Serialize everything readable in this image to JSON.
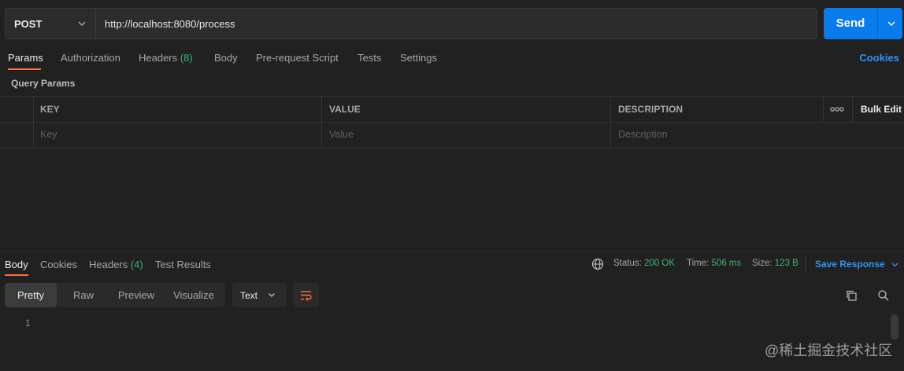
{
  "request": {
    "method": "POST",
    "url": "http://localhost:8080/process",
    "send_label": "Send"
  },
  "request_tabs": [
    {
      "label": "Params",
      "count": ""
    },
    {
      "label": "Authorization",
      "count": ""
    },
    {
      "label": "Headers",
      "count": "(8)"
    },
    {
      "label": "Body",
      "count": ""
    },
    {
      "label": "Pre-request Script",
      "count": ""
    },
    {
      "label": "Tests",
      "count": ""
    },
    {
      "label": "Settings",
      "count": ""
    }
  ],
  "cookies_label": "Cookies",
  "query_params_label": "Query Params",
  "params_table": {
    "headers": [
      "KEY",
      "VALUE",
      "DESCRIPTION"
    ],
    "placeholders": [
      "Key",
      "Value",
      "Description"
    ],
    "more_icon": "ooo",
    "bulk_edit_label": "Bulk Edit"
  },
  "response_tabs": [
    {
      "label": "Body",
      "count": ""
    },
    {
      "label": "Cookies",
      "count": ""
    },
    {
      "label": "Headers",
      "count": "(4)"
    },
    {
      "label": "Test Results",
      "count": ""
    }
  ],
  "response_meta": {
    "status_label": "Status:",
    "status_value": "200 OK",
    "time_label": "Time:",
    "time_value": "506 ms",
    "size_label": "Size:",
    "size_value": "123 B",
    "save_response_label": "Save Response"
  },
  "view_modes": [
    "Pretty",
    "Raw",
    "Preview",
    "Visualize"
  ],
  "format_select": "Text",
  "line_number": "1",
  "watermark": "@稀土掘金技术社区",
  "colors": {
    "accent": "#ff6c37",
    "send": "#097bed",
    "link": "#2e94f5",
    "success": "#3cb371",
    "background": "#212121"
  }
}
